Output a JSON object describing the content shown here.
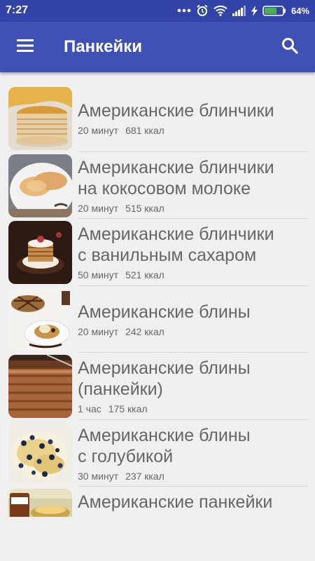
{
  "status_bar": {
    "time": "7:27",
    "battery_percent": "64%"
  },
  "toolbar": {
    "title": "Панкейки",
    "menu_icon": "hamburger-menu-icon",
    "search_icon": "search-icon"
  },
  "colors": {
    "status_bar": "#3244a8",
    "app_bar": "#3f51b5",
    "background": "#efefef",
    "text": "#666666",
    "battery_fill": "#4caf50"
  },
  "recipes": [
    {
      "title_lines": [
        "Американские блинчики"
      ],
      "time": "20 минут",
      "calories": "681 ккал"
    },
    {
      "title_lines": [
        "Американские блинчики",
        "на кокосовом молоке"
      ],
      "time": "20 минут",
      "calories": "515 ккал"
    },
    {
      "title_lines": [
        "Американские блинчики",
        "с ванильным сахаром"
      ],
      "time": "50 минут",
      "calories": "521 ккал"
    },
    {
      "title_lines": [
        "Американские блины"
      ],
      "time": "20 минут",
      "calories": "242 ккал"
    },
    {
      "title_lines": [
        "Американские блины",
        "(панкейки)"
      ],
      "time": "1 час",
      "calories": "175 ккал"
    },
    {
      "title_lines": [
        "Американские блины",
        "с голубикой"
      ],
      "time": "30 минут",
      "calories": "237 ккал"
    },
    {
      "title_lines": [
        "Американские панкейки"
      ],
      "time": "",
      "calories": ""
    }
  ]
}
